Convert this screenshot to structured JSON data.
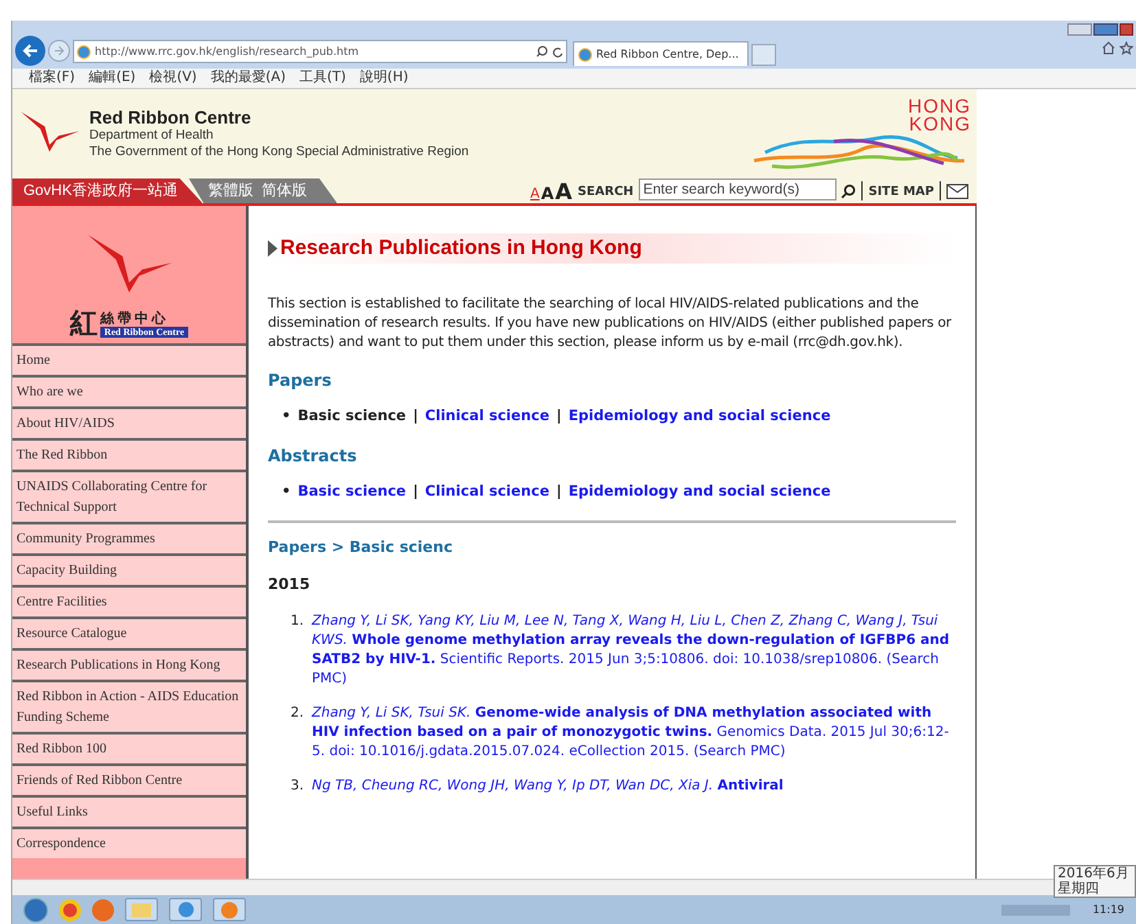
{
  "browser": {
    "address": "http://www.rrc.gov.hk/english/research_pub.htm",
    "tab_title": "Red Ribbon Centre, Dep...",
    "menu": [
      "檔案(F)",
      "編輯(E)",
      "檢視(V)",
      "我的最愛(A)",
      "工具(T)",
      "說明(H)"
    ]
  },
  "header": {
    "title": "Red Ribbon Centre",
    "department": "Department of Health",
    "government": "The Government of the Hong Kong Special Administrative Region",
    "brand": [
      "HONG",
      "KONG"
    ]
  },
  "navbar": {
    "govhk": "GovHK香港政府一站通",
    "languages": [
      "繁體版",
      "简体版"
    ],
    "font_sizes": [
      "A",
      "A",
      "A"
    ],
    "search_label": "SEARCH",
    "search_placeholder": "Enter search keyword(s)",
    "sitemap": "SITE MAP"
  },
  "sidebar": {
    "logo": {
      "big_char": "紅",
      "chars": "絲 帶 中 心",
      "english": "Red Ribbon Centre"
    },
    "items": [
      "Home",
      "Who are we",
      "About HIV/AIDS",
      "The Red Ribbon",
      "UNAIDS Collaborating Centre for Technical Support",
      "Community Programmes",
      "Capacity Building",
      "Centre Facilities",
      "Resource Catalogue",
      "Research Publications in Hong Kong",
      "Red Ribbon in Action - AIDS Education Funding Scheme",
      "Red Ribbon 100",
      "Friends of Red Ribbon Centre",
      "Useful Links",
      "Correspondence"
    ]
  },
  "main": {
    "title": "Research Publications in Hong Kong",
    "intro": "This section is established to facilitate the searching of local HIV/AIDS-related publications and the dissemination of research results. If you have new publications on HIV/AIDS (either published papers or abstracts) and want to put them under this section, please inform us by e-mail (rrc@dh.gov.hk).",
    "separator": "|",
    "bullet": "•",
    "sections": [
      {
        "heading": "Papers",
        "links": [
          {
            "label": "Basic science",
            "selected": true
          },
          {
            "label": "Clinical science",
            "selected": false
          },
          {
            "label": "Epidemiology and social science",
            "selected": false
          }
        ]
      },
      {
        "heading": "Abstracts",
        "links": [
          {
            "label": "Basic science",
            "selected": false
          },
          {
            "label": "Clinical science",
            "selected": false
          },
          {
            "label": "Epidemiology and social science",
            "selected": false
          }
        ]
      }
    ],
    "breadcrumb": "Papers > Basic scienc",
    "year": "2015",
    "publications": [
      {
        "number": "1.",
        "authors": "Zhang Y, Li SK, Yang KY, Liu M, Lee N, Tang X, Wang H, Liu L, Chen Z, Zhang C, Wang J, Tsui KWS.",
        "title": "Whole genome methylation array reveals the down-regulation of IGFBP6 and SATB2 by HIV-1.",
        "source": "Scientific Reports. 2015 Jun 3;5:10806. doi: 10.1038/srep10806. (Search PMC)"
      },
      {
        "number": "2.",
        "authors": "Zhang Y, Li SK, Tsui SK.",
        "title": "Genome-wide analysis of DNA methylation associated with HIV infection based on a pair of monozygotic twins.",
        "source": "Genomics Data. 2015 Jul 30;6:12-5. doi: 10.1016/j.gdata.2015.07.024. eCollection 2015. (Search PMC)"
      },
      {
        "number": "3.",
        "authors": "Ng TB, Cheung RC, Wong JH, Wang Y, Ip DT, Wan DC, Xia J.",
        "title": "Antiviral"
      }
    ]
  },
  "taskbar": {
    "tooltip": [
      "2016年6月",
      "星期四"
    ],
    "clock": "11:19"
  }
}
